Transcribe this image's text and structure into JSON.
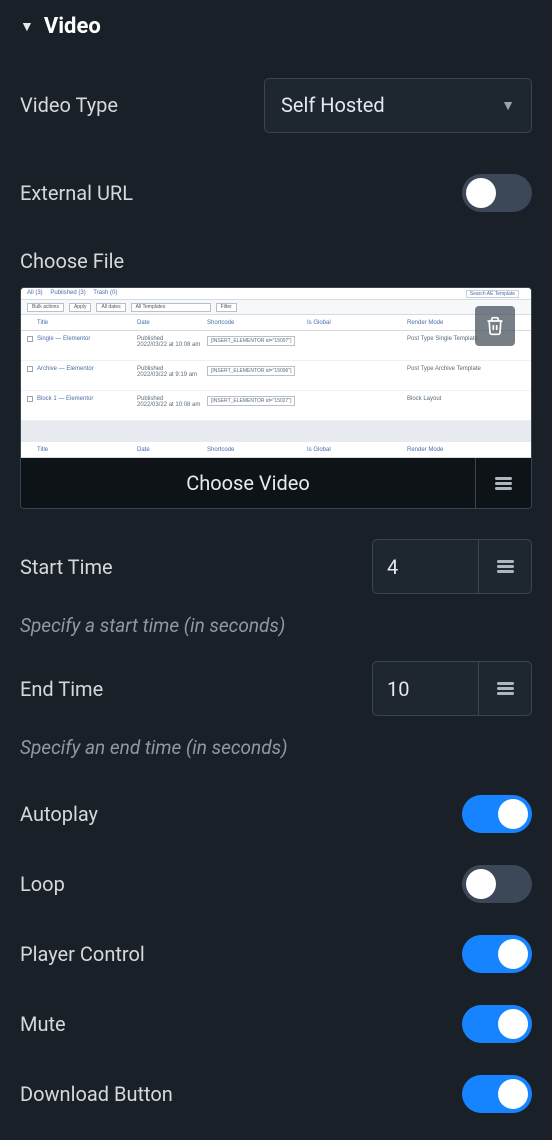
{
  "section": {
    "title": "Video"
  },
  "video_type": {
    "label": "Video Type",
    "value": "Self Hosted"
  },
  "external_url": {
    "label": "External URL",
    "on": false
  },
  "choose_file": {
    "label": "Choose File",
    "button": "Choose Video"
  },
  "thumb": {
    "tabs": {
      "all": "All (3)",
      "published": "Published (3)",
      "trash": "Trash (0)",
      "search": "Search AE Template"
    },
    "controls": {
      "bulk": "Bulk actions",
      "apply": "Apply",
      "dates": "All dates",
      "templates": "All Templates",
      "filter": "Filter"
    },
    "head": {
      "title": "Title",
      "date": "Date",
      "shortcode": "Shortcode",
      "global": "Is Global",
      "render": "Render Mode"
    },
    "rows": [
      {
        "title": "Single — Elementor",
        "date1": "Published",
        "date2": "2022/03/22 at 10:08 am",
        "sc": "[INSERT_ELEMENTOR id=\"15097\"]",
        "render": "Post Type Single Template"
      },
      {
        "title": "Archive — Elementor",
        "date1": "Published",
        "date2": "2022/03/22 at 9:19 am",
        "sc": "[INSERT_ELEMENTOR id=\"15096\"]",
        "render": "Post Type Archive Template"
      },
      {
        "title": "Block 1 — Elementor",
        "date1": "Published",
        "date2": "2022/03/22 at 10:08 am",
        "sc": "[INSERT_ELEMENTOR id=\"15027\"]",
        "render": "Block Layout"
      }
    ]
  },
  "start_time": {
    "label": "Start Time",
    "value": "4",
    "hint": "Specify a start time (in seconds)"
  },
  "end_time": {
    "label": "End Time",
    "value": "10",
    "hint": "Specify an end time (in seconds)"
  },
  "toggles": {
    "autoplay": {
      "label": "Autoplay",
      "on": true
    },
    "loop": {
      "label": "Loop",
      "on": false
    },
    "player_control": {
      "label": "Player Control",
      "on": true
    },
    "mute": {
      "label": "Mute",
      "on": true
    },
    "download": {
      "label": "Download Button",
      "on": true
    }
  }
}
